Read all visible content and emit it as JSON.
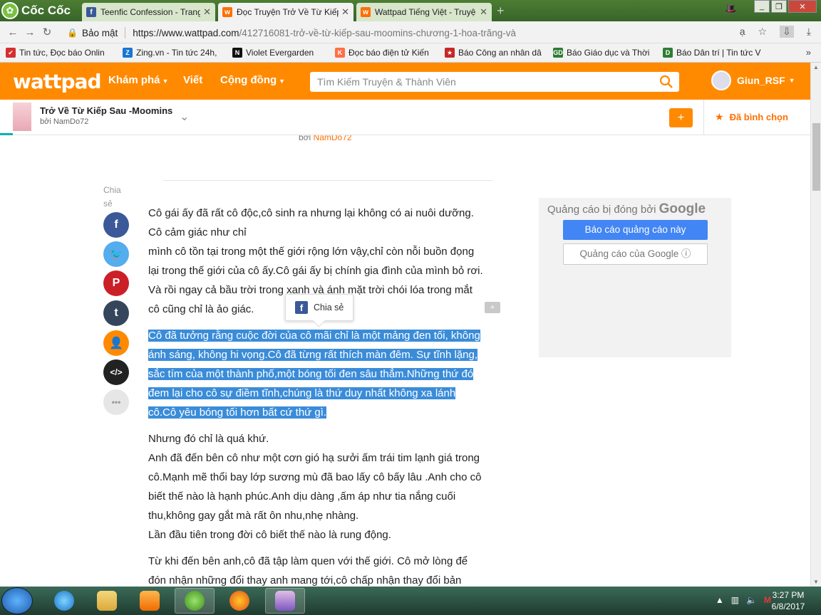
{
  "browser": {
    "brand": "Cốc Cốc",
    "tabs": [
      {
        "title": "Teenfic Confession - Trang",
        "icon": "facebook-icon",
        "active": false
      },
      {
        "title": "Đọc Truyện Trở Về Từ Kiếp",
        "icon": "wattpad-icon",
        "active": true
      },
      {
        "title": "Wattpad Tiếng Việt - Truyệ",
        "icon": "wattpad-icon",
        "active": false
      }
    ],
    "security_label": "Bảo mật",
    "url_host": "https://www.wattpad.com",
    "url_path": "/412716081-trở-về-từ-kiếp-sau-moomins-chương-1-hoa-trăng-và",
    "translate_glyph": "ạ"
  },
  "bookmarks": [
    {
      "label": "Tin tức, Đọc báo Onlin",
      "color": "#d32f2f",
      "glyph": "✔"
    },
    {
      "label": "Zing.vn - Tin tức 24h,",
      "color": "#1976d2",
      "glyph": "Z"
    },
    {
      "label": "Violet Evergarden",
      "color": "#111111",
      "glyph": "N"
    },
    {
      "label": "Đọc báo điện tử Kiến",
      "color": "#ff7043",
      "glyph": "K"
    },
    {
      "label": "Báo Công an nhân dâ",
      "color": "#c62828",
      "glyph": "★"
    },
    {
      "label": "Báo Giáo dục và Thời",
      "color": "#2e7d32",
      "glyph": "GD"
    },
    {
      "label": "Báo Dân trí | Tin tức V",
      "color": "#2e7d32",
      "glyph": "D"
    }
  ],
  "wattpad": {
    "logo": "wattpad",
    "nav": {
      "explore": "Khám phá",
      "write": "Viết",
      "community": "Cộng đồng"
    },
    "search_placeholder": "Tìm Kiếm Truyện & Thành Viên",
    "username": "Giun_RSF"
  },
  "story": {
    "title": "Trở Về Từ Kiếp Sau -Moomins",
    "author_line": "bởi NamDo72",
    "add_label": "+",
    "vote_label": "Đã bình chọn"
  },
  "content": {
    "byline_prefix": "bởi ",
    "byline_author": "NamDo72",
    "share_label": "Chia sẻ",
    "share_buttons": [
      {
        "name": "facebook-share-icon",
        "color": "#3b5998",
        "glyph": "f"
      },
      {
        "name": "twitter-share-icon",
        "color": "#55acee",
        "glyph": "🐦"
      },
      {
        "name": "pinterest-share-icon",
        "color": "#cb2027",
        "glyph": "P"
      },
      {
        "name": "tumblr-share-icon",
        "color": "#35465c",
        "glyph": "t"
      },
      {
        "name": "profile-share-icon",
        "color": "#ff8a00",
        "glyph": "👤"
      },
      {
        "name": "embed-share-icon",
        "color": "#222222",
        "glyph": "</>"
      },
      {
        "name": "more-share-icon",
        "color": "#e6e6e6",
        "glyph": "•••"
      }
    ],
    "para1": [
      "Cô gái ấy đã rất cô độc,cô sinh ra nhưng lại không có ai nuôi dưỡng.",
      "Cô cảm giác như chỉ",
      "mình cô tồn tại trong một thế giới rộng lớn vậy,chỉ còn nỗi buồn đọng",
      "lại trong thế giới của cô ấy.Cô gái ấy bị chính gia đình của mình bỏ rơi.",
      "Và rồi ngay cả bầu trời trong xanh và ánh mặt trời chói lóa trong mắt",
      "cô cũng chỉ là ảo giác."
    ],
    "para2_highlighted": [
      "Cô đã tưởng rằng cuộc đời của cô mãi chỉ là một mảng đen tối, không",
      "ánh sáng, không hi vọng.Cô đã từng rất thích màn đêm. Sự tĩnh lặng,",
      "sắc tím của một thành phố,một bóng tối đen sâu thẳm.Những thứ đó",
      "đem lại cho cô sự điềm tĩnh,chúng là thứ duy nhất không xa lánh",
      "cô.Cô yêu bóng tối hơn bất cứ thứ gì."
    ],
    "para3": [
      "Nhưng đó chỉ là quá khứ.",
      "Anh đã đến bên cô như một cơn gió hạ sưởi ấm trái tim lạnh giá trong",
      "cô.Mạnh mẽ thổi bay lớp sương mù đã bao lấy cô bấy lâu .Anh cho cô",
      "biết thế nào là hạnh phúc.Anh dịu dàng ,ấm áp như tia nắng cuối",
      "thu,không gay gắt mà rất ôn nhu,nhẹ nhàng.",
      "Lần đầu tiên trong đời cô biết thế nào là rung động."
    ],
    "para4": [
      "Từ khi đến bên anh,cô đã tập làm quen với thế giới. Cô mở lòng để",
      "đón nhận những đổi thay anh mang tới,cô chấp nhận thay đổi bản"
    ],
    "fb_popup_label": "Chia sẻ",
    "comment_glyph": "+"
  },
  "ad": {
    "closed_prefix": "Quảng cáo bị đóng bởi ",
    "closed_brand": "Google",
    "report_button": "Báo cáo quảng cáo này",
    "why_button": "Quảng cáo của Google ⓘ"
  },
  "taskbar": {
    "time": "3:27 PM",
    "date": "6/8/2017"
  }
}
